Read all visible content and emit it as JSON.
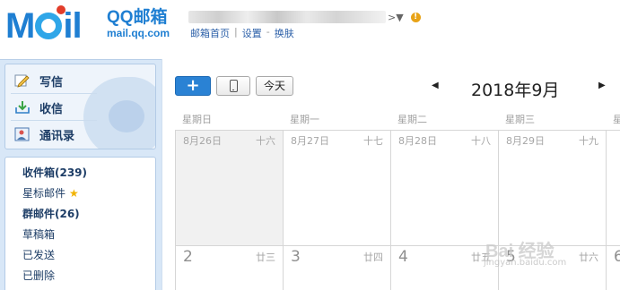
{
  "header": {
    "logo_text": "MOil",
    "brand_name": "QQ邮箱",
    "brand_domain": "mail.qq.com",
    "user_caret": ">▼",
    "warning_symbol": "!",
    "links": {
      "home": "邮箱首页",
      "separator": "|",
      "settings": "设置",
      "dash": "-",
      "switch": "换肤"
    }
  },
  "sidebar": {
    "quick_actions": [
      {
        "label": "写信",
        "icon": "pencil-icon"
      },
      {
        "label": "收信",
        "icon": "inbox-download-icon"
      },
      {
        "label": "通讯录",
        "icon": "address-book-icon"
      }
    ],
    "folders": [
      {
        "label": "收件箱(239)",
        "bold": true
      },
      {
        "label": "星标邮件",
        "bold": false,
        "star": "★"
      },
      {
        "label": "群邮件(26)",
        "bold": true
      },
      {
        "label": "草稿箱",
        "bold": false
      },
      {
        "label": "已发送",
        "bold": false
      },
      {
        "label": "已删除",
        "bold": false
      }
    ]
  },
  "calendar": {
    "toolbar": {
      "add_label": "+",
      "today_label": "今天"
    },
    "prev_arrow": "◀",
    "next_arrow": "▶",
    "month_title": "2018年9月",
    "weekdays": [
      "星期日",
      "星期一",
      "星期二",
      "星期三",
      "星期四"
    ],
    "rows": [
      [
        {
          "day": "8月26日",
          "lunar": "十六",
          "past": true
        },
        {
          "day": "8月27日",
          "lunar": "十七",
          "past": false
        },
        {
          "day": "8月28日",
          "lunar": "十八",
          "past": false
        },
        {
          "day": "8月29日",
          "lunar": "十九",
          "past": false
        },
        {
          "day": "",
          "lunar": "",
          "past": false
        }
      ],
      [
        {
          "day": "2",
          "lunar": "廿三",
          "past": false,
          "big": true
        },
        {
          "day": "3",
          "lunar": "廿四",
          "past": false,
          "big": true
        },
        {
          "day": "4",
          "lunar": "廿五",
          "past": false,
          "big": true
        },
        {
          "day": "5",
          "lunar": "廿六",
          "past": false,
          "big": true
        },
        {
          "day": "6",
          "lunar": "",
          "past": false,
          "big": true
        }
      ]
    ]
  },
  "watermark": {
    "text": "Bai 经验",
    "sub": "jingyan.baidu.com"
  },
  "colors": {
    "brand_blue": "#1f7fd2",
    "add_button": "#2a82d4",
    "sidebar_bg": "#d8e7f7",
    "past_cell": "#f1f1f1"
  }
}
